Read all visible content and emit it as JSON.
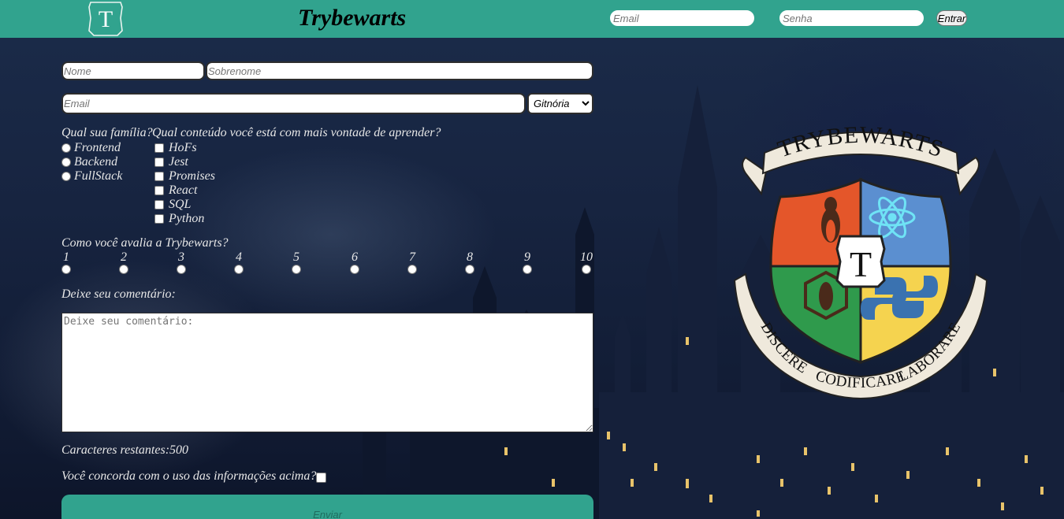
{
  "header": {
    "logo_letter": "T",
    "title": "Trybewarts",
    "email_placeholder": "Email",
    "password_placeholder": "Senha",
    "login_button": "Entrar"
  },
  "form": {
    "name_placeholder": "Nome",
    "lastname_placeholder": "Sobrenome",
    "email_placeholder": "Email",
    "house_selected": "Gitnória",
    "family_label": "Qual sua família?",
    "family_options": [
      "Frontend",
      "Backend",
      "FullStack"
    ],
    "content_label": "Qual conteúdo você está com mais vontade de aprender?",
    "content_options": [
      "HoFs",
      "Jest",
      "Promises",
      "React",
      "SQL",
      "Python"
    ],
    "rating_label": "Como você avalia a Trybewarts?",
    "rating_options": [
      "1",
      "2",
      "3",
      "4",
      "5",
      "6",
      "7",
      "8",
      "9",
      "10"
    ],
    "comment_label": "Deixe seu comentário:",
    "comment_placeholder": "Deixe seu comentário:",
    "counter_label": "Caracteres restantes:",
    "counter_value": "500",
    "agreement_label": "Você concorda com o uso das informações acima?",
    "submit_label": "Enviar"
  },
  "crest": {
    "banner_text": "TRYBEWARTS",
    "center_letter": "T",
    "motto_left": "DISCERE",
    "motto_center": "CODIFICARE",
    "motto_right": "LABORARE"
  },
  "colors": {
    "header_bg": "#31a38e",
    "crest_red": "#e4562a",
    "crest_blue": "#5b8fd0",
    "crest_green": "#2f9a4c",
    "crest_yellow": "#f5d34f"
  }
}
